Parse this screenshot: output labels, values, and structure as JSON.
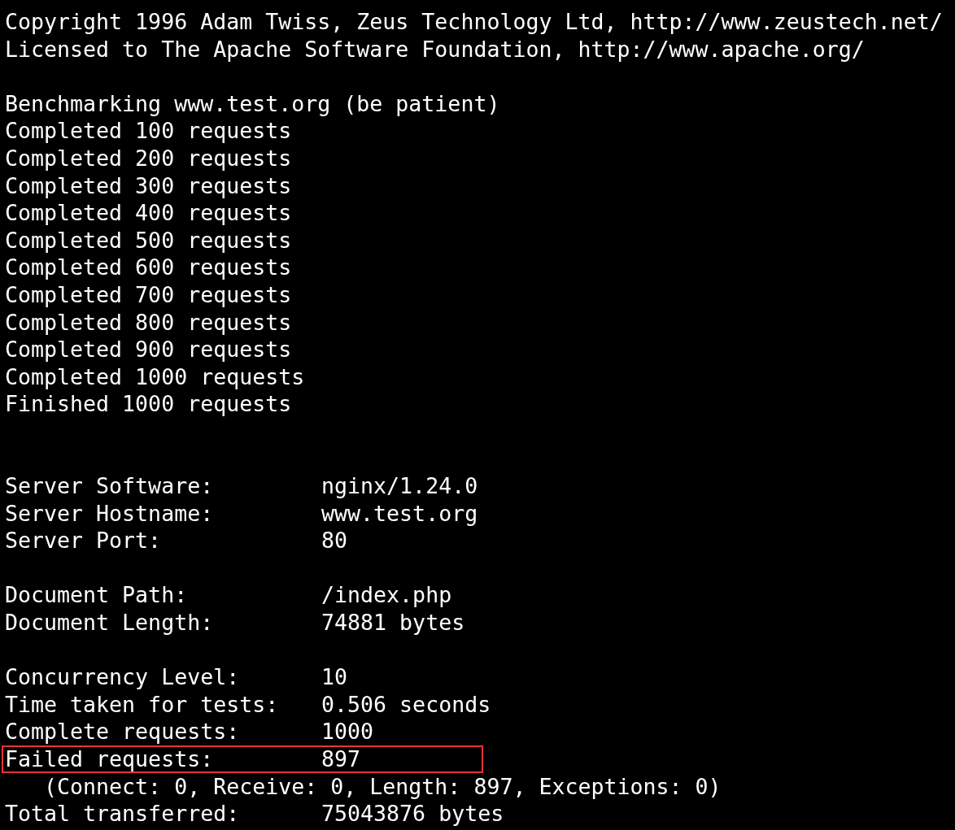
{
  "terminal": {
    "lines": [
      {
        "kind": "text",
        "text": "Copyright 1996 Adam Twiss, Zeus Technology Ltd, http://www.zeustech.net/"
      },
      {
        "kind": "text",
        "text": "Licensed to The Apache Software Foundation, http://www.apache.org/"
      },
      {
        "kind": "blank"
      },
      {
        "kind": "text",
        "text": "Benchmarking www.test.org (be patient)"
      },
      {
        "kind": "text",
        "text": "Completed 100 requests"
      },
      {
        "kind": "text",
        "text": "Completed 200 requests"
      },
      {
        "kind": "text",
        "text": "Completed 300 requests"
      },
      {
        "kind": "text",
        "text": "Completed 400 requests"
      },
      {
        "kind": "text",
        "text": "Completed 500 requests"
      },
      {
        "kind": "text",
        "text": "Completed 600 requests"
      },
      {
        "kind": "text",
        "text": "Completed 700 requests"
      },
      {
        "kind": "text",
        "text": "Completed 800 requests"
      },
      {
        "kind": "text",
        "text": "Completed 900 requests"
      },
      {
        "kind": "text",
        "text": "Completed 1000 requests"
      },
      {
        "kind": "text",
        "text": "Finished 1000 requests"
      },
      {
        "kind": "blank"
      },
      {
        "kind": "blank"
      },
      {
        "kind": "field",
        "label": "Server Software:",
        "value": "nginx/1.24.0",
        "highlighted": false
      },
      {
        "kind": "field",
        "label": "Server Hostname:",
        "value": "www.test.org",
        "highlighted": false
      },
      {
        "kind": "field",
        "label": "Server Port:",
        "value": "80",
        "highlighted": false
      },
      {
        "kind": "blank"
      },
      {
        "kind": "field",
        "label": "Document Path:",
        "value": "/index.php",
        "highlighted": false
      },
      {
        "kind": "field",
        "label": "Document Length:",
        "value": "74881 bytes",
        "highlighted": false
      },
      {
        "kind": "blank"
      },
      {
        "kind": "field",
        "label": "Concurrency Level:",
        "value": "10",
        "highlighted": false
      },
      {
        "kind": "field",
        "label": "Time taken for tests:",
        "value": "0.506 seconds",
        "highlighted": false
      },
      {
        "kind": "field",
        "label": "Complete requests:",
        "value": "1000",
        "highlighted": false
      },
      {
        "kind": "field",
        "label": "Failed requests:",
        "value": "897",
        "highlighted": true
      },
      {
        "kind": "indented",
        "text": "(Connect: 0, Receive: 0, Length: 897, Exceptions: 0)"
      },
      {
        "kind": "field",
        "label": "Total transferred:",
        "value": "75043876 bytes",
        "highlighted": false
      }
    ]
  }
}
